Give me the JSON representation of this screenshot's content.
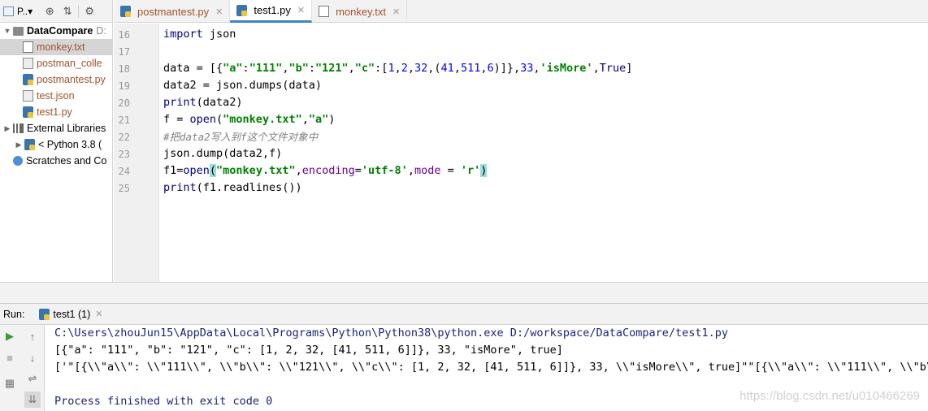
{
  "project": {
    "toolbar_title": "P..▾",
    "tree": [
      {
        "label": "DataCompare",
        "suffix": "D:",
        "kind": "folder",
        "expanded": true
      },
      {
        "label": "monkey.txt",
        "kind": "txt",
        "selected": true
      },
      {
        "label": "postman_colle",
        "kind": "json"
      },
      {
        "label": "postmantest.py",
        "kind": "py"
      },
      {
        "label": "test.json",
        "kind": "json"
      },
      {
        "label": "test1.py",
        "kind": "py"
      },
      {
        "label": "External Libraries",
        "kind": "lib"
      },
      {
        "label": "< Python 3.8 (",
        "kind": "python"
      },
      {
        "label": "Scratches and Co",
        "kind": "scratch"
      }
    ]
  },
  "tabs": [
    {
      "label": "postmantest.py",
      "active": false
    },
    {
      "label": "test1.py",
      "active": true
    },
    {
      "label": "monkey.txt",
      "active": false
    }
  ],
  "editor": {
    "line_numbers": [
      "16",
      "17",
      "18",
      "19",
      "20",
      "21",
      "22",
      "23",
      "24",
      "25"
    ],
    "lines": [
      "import json",
      "",
      "data = [{\"a\":\"111\",\"b\":\"121\",\"c\":[1,2,32,(41,511,6)]},33,'isMore',True]",
      "data2 = json.dumps(data)",
      "print(data2)",
      "f = open(\"monkey.txt\",\"a\")",
      "#把data2写入到f这个文件对象中",
      "json.dump(data2,f)",
      "f1=open(\"monkey.txt\",encoding='utf-8',mode = 'r')",
      "print(f1.readlines())"
    ]
  },
  "run": {
    "label": "Run:",
    "tab_label": "test1 (1)",
    "output": [
      "C:\\Users\\zhouJun15\\AppData\\Local\\Programs\\Python\\Python38\\python.exe D:/workspace/DataCompare/test1.py",
      "[{\"a\": \"111\", \"b\": \"121\", \"c\": [1, 2, 32, [41, 511, 6]]}, 33, \"isMore\", true]",
      "['\"[{\\\\\"a\\\\\": \\\\\"111\\\\\", \\\\\"b\\\\\": \\\\\"121\\\\\", \\\\\"c\\\\\": [1, 2, 32, [41, 511, 6]]}, 33, \\\\\"isMore\\\\\", true]\"\"[{\\\\\"a\\\\\": \\\\\"111\\\\\", \\\\\"b\\\\",
      "",
      "Process finished with exit code 0"
    ]
  },
  "watermark": "https://blog.csdn.net/u010466269"
}
